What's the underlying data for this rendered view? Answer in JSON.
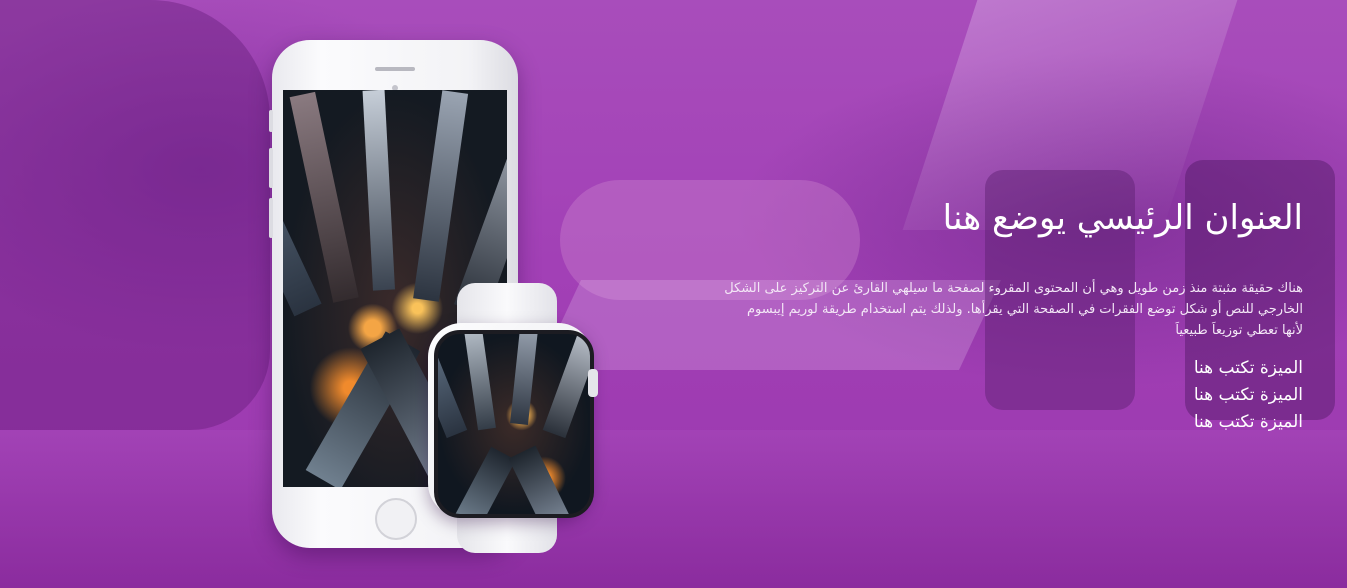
{
  "hero": {
    "title": "العنوان الرئيسي يوضع هنا",
    "description": "هناك حقيقة مثبتة منذ زمن طويل وهي أن المحتوى المقروء لصفحة ما سيلهي القارئ عن التركيز على الشكل الخارجي للنص أو شكل توضع الفقرات في الصفحة التي يقرأها. ولذلك يتم استخدام طريقة لوريم إيبسوم لأنها تعطي توزيعاَ طبيعياَ",
    "features": [
      "الميزة تكتب هنا",
      "الميزة تكتب هنا",
      "الميزة تكتب هنا"
    ]
  },
  "colors": {
    "overlay": "#a240b6",
    "text": "#ffffff"
  }
}
